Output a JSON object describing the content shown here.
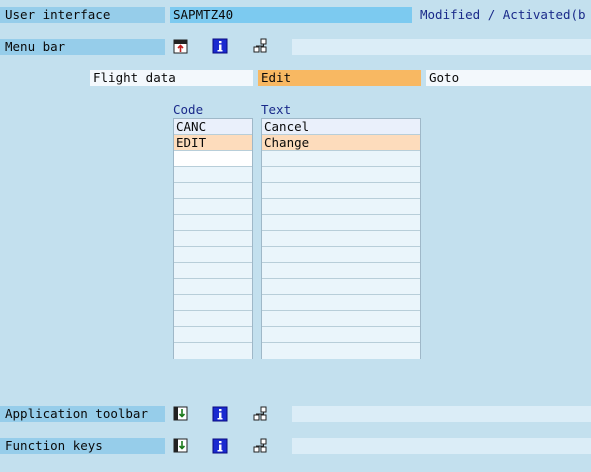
{
  "rows": {
    "user_interface": {
      "label": "User interface",
      "value": "SAPMTZ40",
      "status": "Modified / Activated(b"
    },
    "menu_bar": {
      "label": "Menu bar"
    },
    "application_toolbar": {
      "label": "Application toolbar"
    },
    "function_keys": {
      "label": "Function keys"
    }
  },
  "menus": [
    {
      "label": "Flight data"
    },
    {
      "label": "Edit"
    },
    {
      "label": "Goto"
    }
  ],
  "menu_items": {
    "headers": {
      "code": "Code",
      "text": "Text"
    },
    "entries": [
      {
        "code": "CANC",
        "text": "Cancel"
      },
      {
        "code": "EDIT",
        "text": "Change"
      }
    ]
  },
  "icons": {
    "expand": "expand-menu-icon",
    "info": "info-icon",
    "hierarchy": "hierarchy-icon"
  },
  "colors": {
    "background": "#c3e0ee",
    "label_bg": "#96cdea",
    "selected_menu": "#f8b862",
    "selected_row": "#fddcbc",
    "name_field": "#7ccaf0"
  }
}
